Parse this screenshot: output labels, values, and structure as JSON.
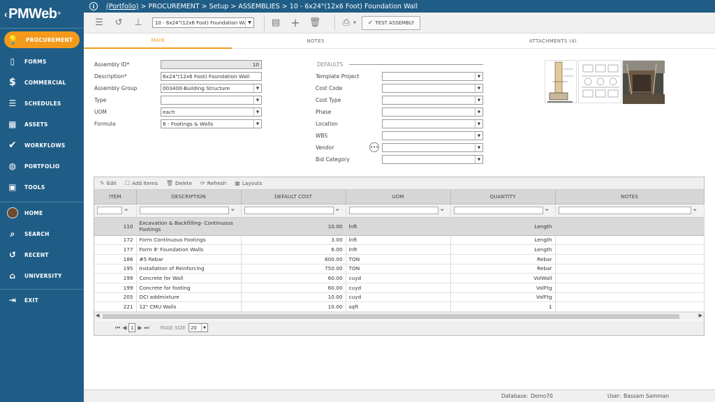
{
  "brand": {
    "logo_text": "PMWeb",
    "logo_mark": "®"
  },
  "nav": {
    "items": [
      {
        "label": "PROCUREMENT",
        "icon": "lightbulb-icon",
        "glyph": "💡",
        "active": true
      },
      {
        "label": "FORMS",
        "icon": "document-icon",
        "glyph": "🗋"
      },
      {
        "label": "COMMERCIAL",
        "icon": "dollar-icon",
        "glyph": "$"
      },
      {
        "label": "SCHEDULES",
        "icon": "gantt-icon",
        "glyph": "☰"
      },
      {
        "label": "ASSETS",
        "icon": "building-icon",
        "glyph": "▦"
      },
      {
        "label": "WORKFLOWS",
        "icon": "checkmark-icon",
        "glyph": "✔"
      },
      {
        "label": "PORTFOLIO",
        "icon": "globe-icon",
        "glyph": "🌐"
      },
      {
        "label": "TOOLS",
        "icon": "toolbox-icon",
        "glyph": "🧰"
      },
      {
        "label": "HOME",
        "icon": "avatar-icon",
        "glyph": ""
      },
      {
        "label": "SEARCH",
        "icon": "search-icon",
        "glyph": "🔍"
      },
      {
        "label": "RECENT",
        "icon": "history-icon",
        "glyph": "↺"
      },
      {
        "label": "UNIVERSITY",
        "icon": "graduation-cap-icon",
        "glyph": "🎓"
      },
      {
        "label": "EXIT",
        "icon": "exit-icon",
        "glyph": "⇥"
      }
    ]
  },
  "topbar": {
    "breadcrumb_link": "(Portfolio)",
    "breadcrumb_rest": " > PROCUREMENT > Setup > ASSEMBLIES > 10 - 6x24\"(12x6 Foot) Foundation Wall"
  },
  "toolbar": {
    "record_select": "10 - 6x24\"(12x6 Foot) Foundation Wall",
    "test_assembly_label": "TEST ASSEMBLY"
  },
  "tabs": [
    {
      "label": "MAIN",
      "active": true
    },
    {
      "label": "NOTES",
      "active": false
    },
    {
      "label": "ATTACHMENTS (4)",
      "active": false
    }
  ],
  "form": {
    "assembly_id": {
      "label": "Assembly ID*",
      "value": "10"
    },
    "description": {
      "label": "Description*",
      "value": "6x24\"(12x6 Foot) Foundation Wall"
    },
    "assembly_group": {
      "label": "Assembly Group",
      "value": "003400-Building Structure"
    },
    "type": {
      "label": "Type",
      "value": ""
    },
    "uom": {
      "label": "UOM",
      "value": "each"
    },
    "formula": {
      "label": "Formula",
      "value": "6 - Footings & Walls"
    }
  },
  "defaults": {
    "header": "DEFAULTS",
    "template_project": {
      "label": "Template Project",
      "value": ""
    },
    "cost_code": {
      "label": "Cost Code",
      "value": ""
    },
    "cost_type": {
      "label": "Cost Type",
      "value": ""
    },
    "phase": {
      "label": "Phase",
      "value": ""
    },
    "location": {
      "label": "Location",
      "value": ""
    },
    "wbs": {
      "label": "WBS",
      "value": ""
    },
    "vendor": {
      "label": "Vendor",
      "value": ""
    },
    "bid_category": {
      "label": "Bid Category",
      "value": ""
    }
  },
  "grid": {
    "toolbar": {
      "edit": "Edit",
      "add_items": "Add Items",
      "delete": "Delete",
      "refresh": "Refresh",
      "layouts": "Layouts"
    },
    "columns": [
      "ITEM",
      "DESCRIPTION",
      "DEFAULT COST",
      "UOM",
      "QUANTITY",
      "NOTES"
    ],
    "group_row": {
      "item": "110",
      "description": "Excavation & Backfilling- Continuous Footings",
      "cost": "10.00",
      "uom": "lnft",
      "quantity": "Length",
      "notes": ""
    },
    "rows": [
      {
        "item": "172",
        "description": "Form Continuous Footings",
        "cost": "3.00",
        "uom": "lnft",
        "quantity": "Length",
        "notes": ""
      },
      {
        "item": "177",
        "description": "Form 8' Foundation Walls",
        "cost": "6.00",
        "uom": "lnft",
        "quantity": "Length",
        "notes": ""
      },
      {
        "item": "186",
        "description": "#5 Rebar",
        "cost": "600.00",
        "uom": "TON",
        "quantity": "Rebar",
        "notes": ""
      },
      {
        "item": "195",
        "description": "Installation of Reinforcing",
        "cost": "750.00",
        "uom": "TON",
        "quantity": "Rebar",
        "notes": ""
      },
      {
        "item": "199",
        "description": "Concrete for Wall",
        "cost": "60.00",
        "uom": "cuyd",
        "quantity": "VolWall",
        "notes": ""
      },
      {
        "item": "199",
        "description": "Concrete for footing",
        "cost": "60.00",
        "uom": "cuyd",
        "quantity": "VolFtg",
        "notes": ""
      },
      {
        "item": "205",
        "description": "DCI addmixture",
        "cost": "10.00",
        "uom": "cuyd",
        "quantity": "VolFtg",
        "notes": ""
      },
      {
        "item": "221",
        "description": "12\" CMU Walls",
        "cost": "10.00",
        "uom": "sqft",
        "quantity": "1",
        "notes": ""
      }
    ],
    "pager": {
      "page": "1",
      "page_size_label": "PAGE SIZE",
      "page_size": "20"
    }
  },
  "status": {
    "database_label": "Database:",
    "database_value": "Demo70",
    "user_label": "User:",
    "user_value": "Bassam Samman"
  },
  "colors": {
    "sidebar": "#1f5d86",
    "accent": "#f39a1d"
  }
}
